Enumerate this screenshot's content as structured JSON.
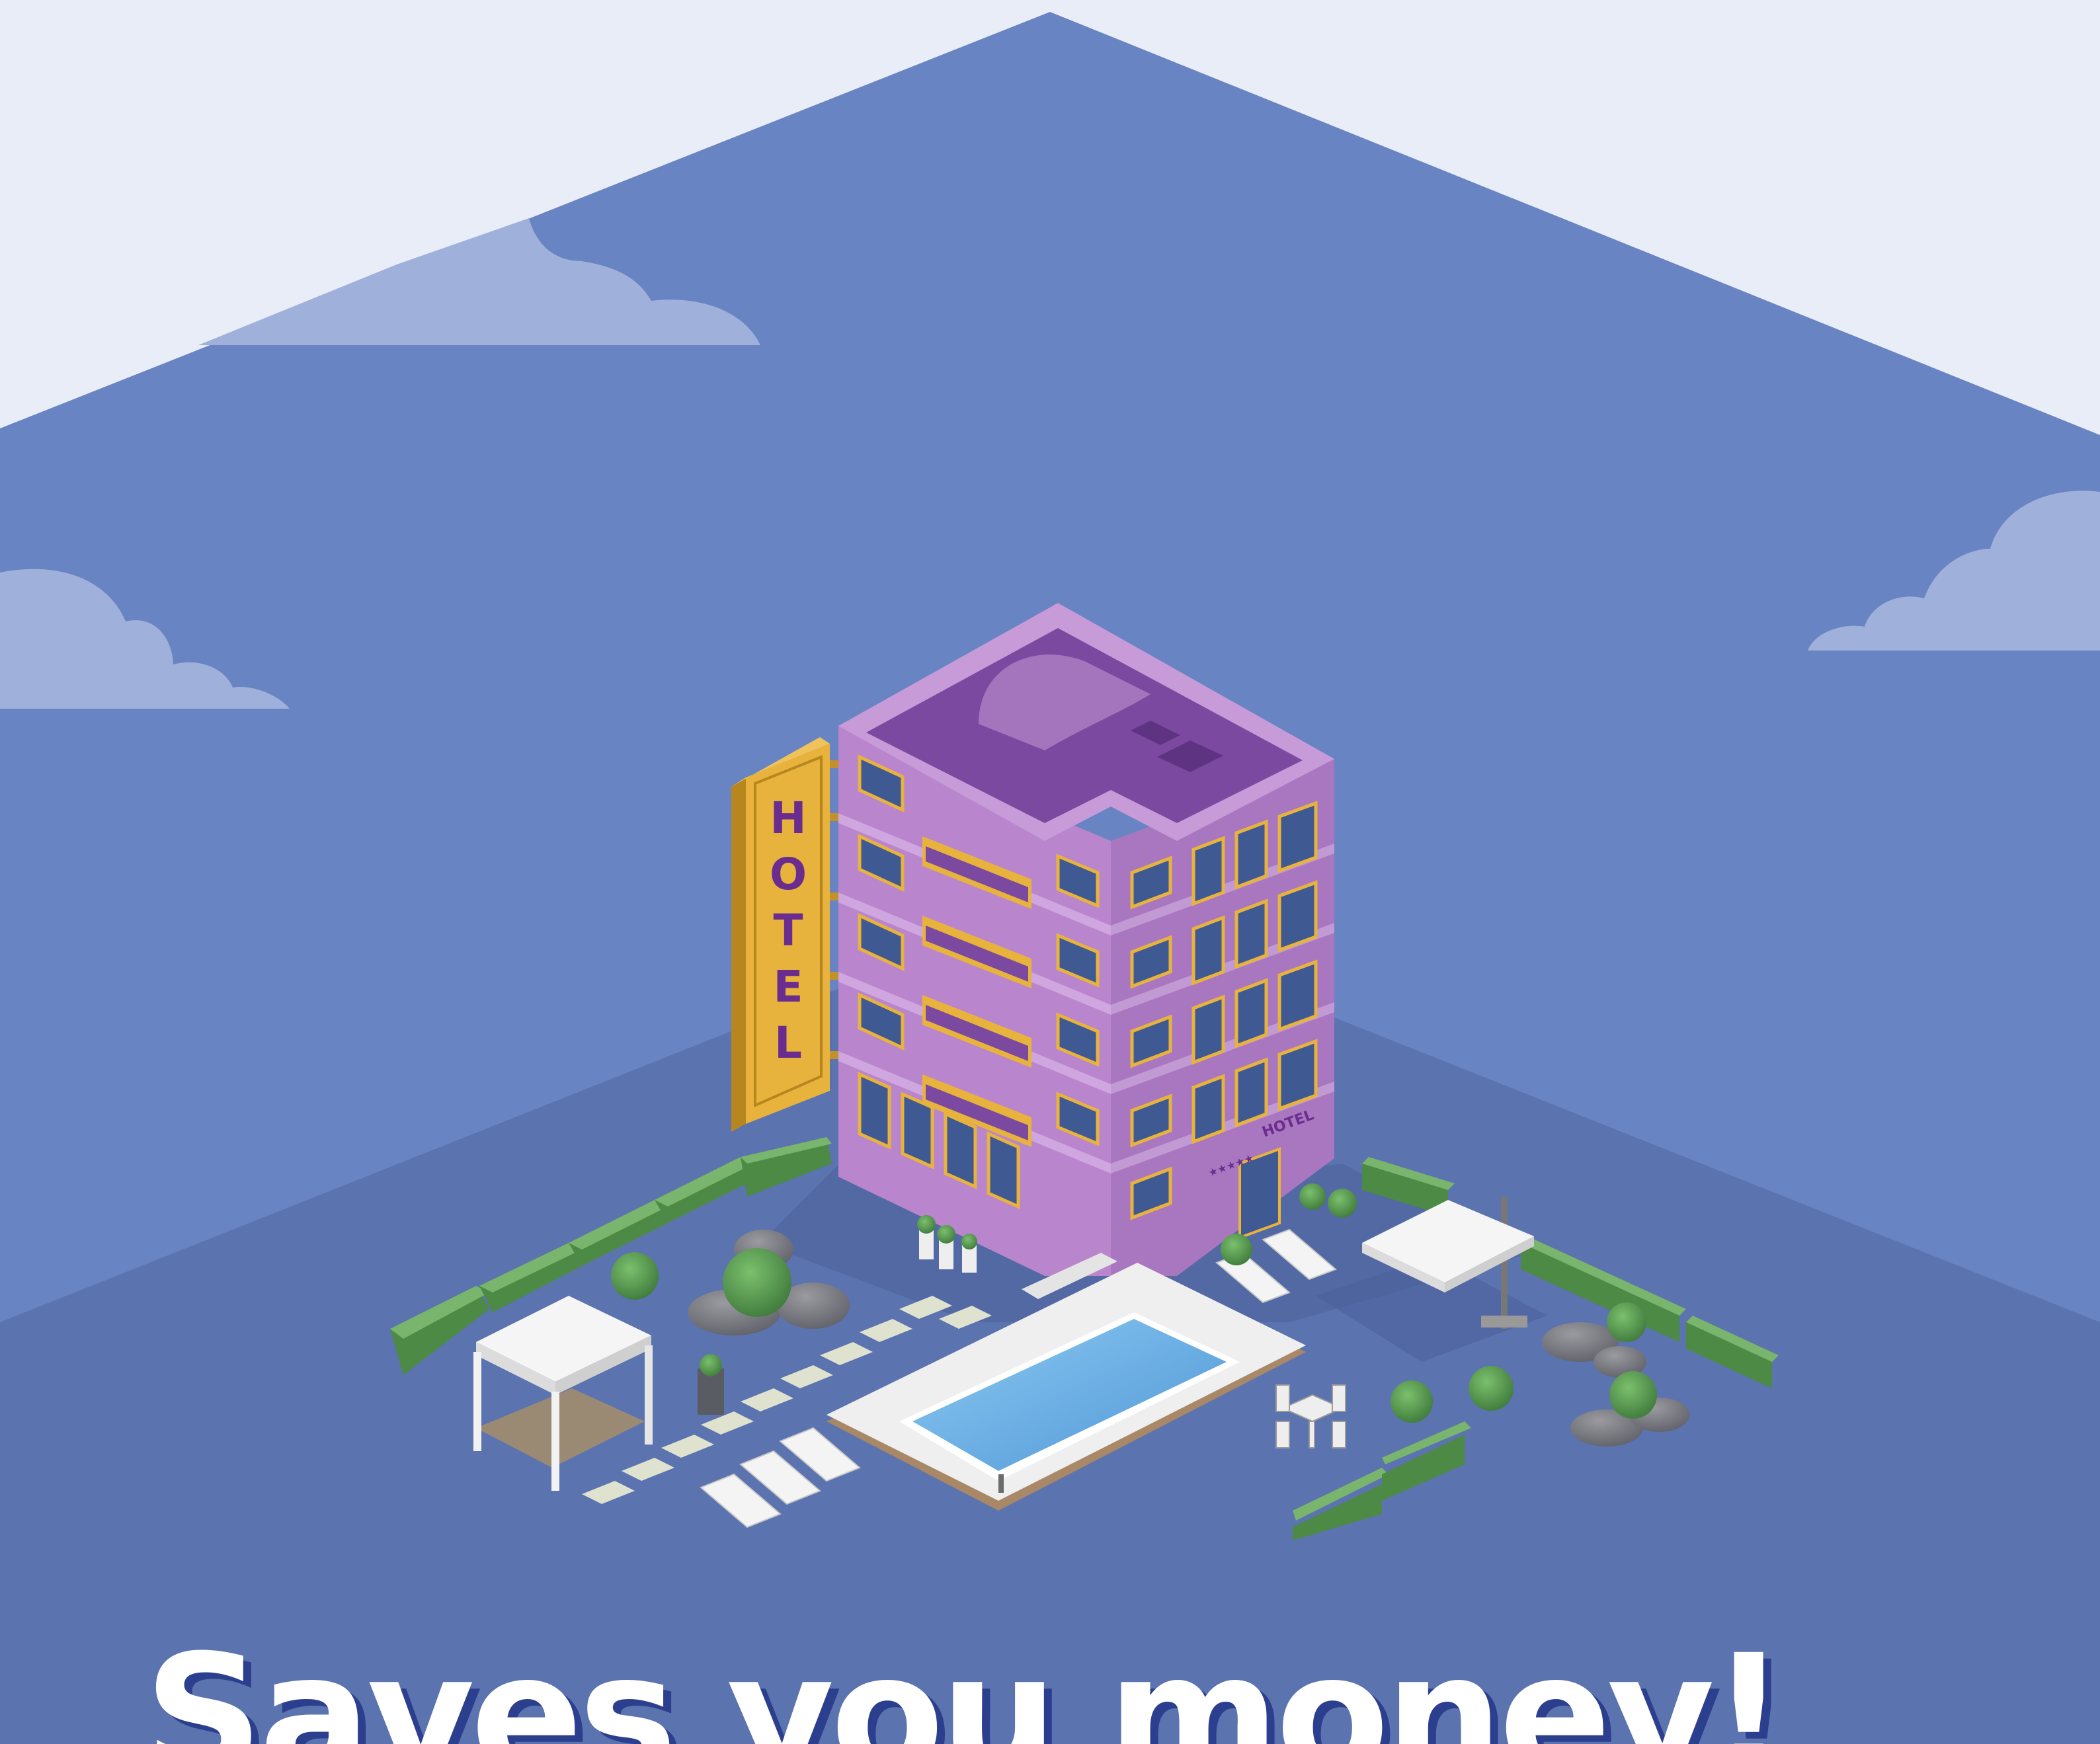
{
  "headline": "Saves you money!",
  "building": {
    "sign_letters": [
      "H",
      "O",
      "T",
      "E",
      "L"
    ],
    "facade_label": "HOTEL",
    "stars": "★★★★★"
  },
  "icons": {
    "sign": "hotel-sign-icon",
    "gazebo": "gazebo-icon",
    "pool": "swimming-pool-icon",
    "umbrella": "patio-umbrella-icon",
    "table": "patio-table-icon"
  },
  "colors": {
    "background": "#e9edf7",
    "sky": "#6984c2",
    "ground": "#5b73ae",
    "cloud": "#9fb1da",
    "building_top": "#7b4aa0",
    "building_left": "#b985cc",
    "building_right": "#a977c0",
    "sign": "#e8b33d",
    "sign_text": "#6a2d8f",
    "hedge": "#5f9a55",
    "pool_water": "#6cb3e8",
    "deck": "#efefef",
    "headline": "#ffffff",
    "headline_shadow": "#2c3f8f"
  }
}
